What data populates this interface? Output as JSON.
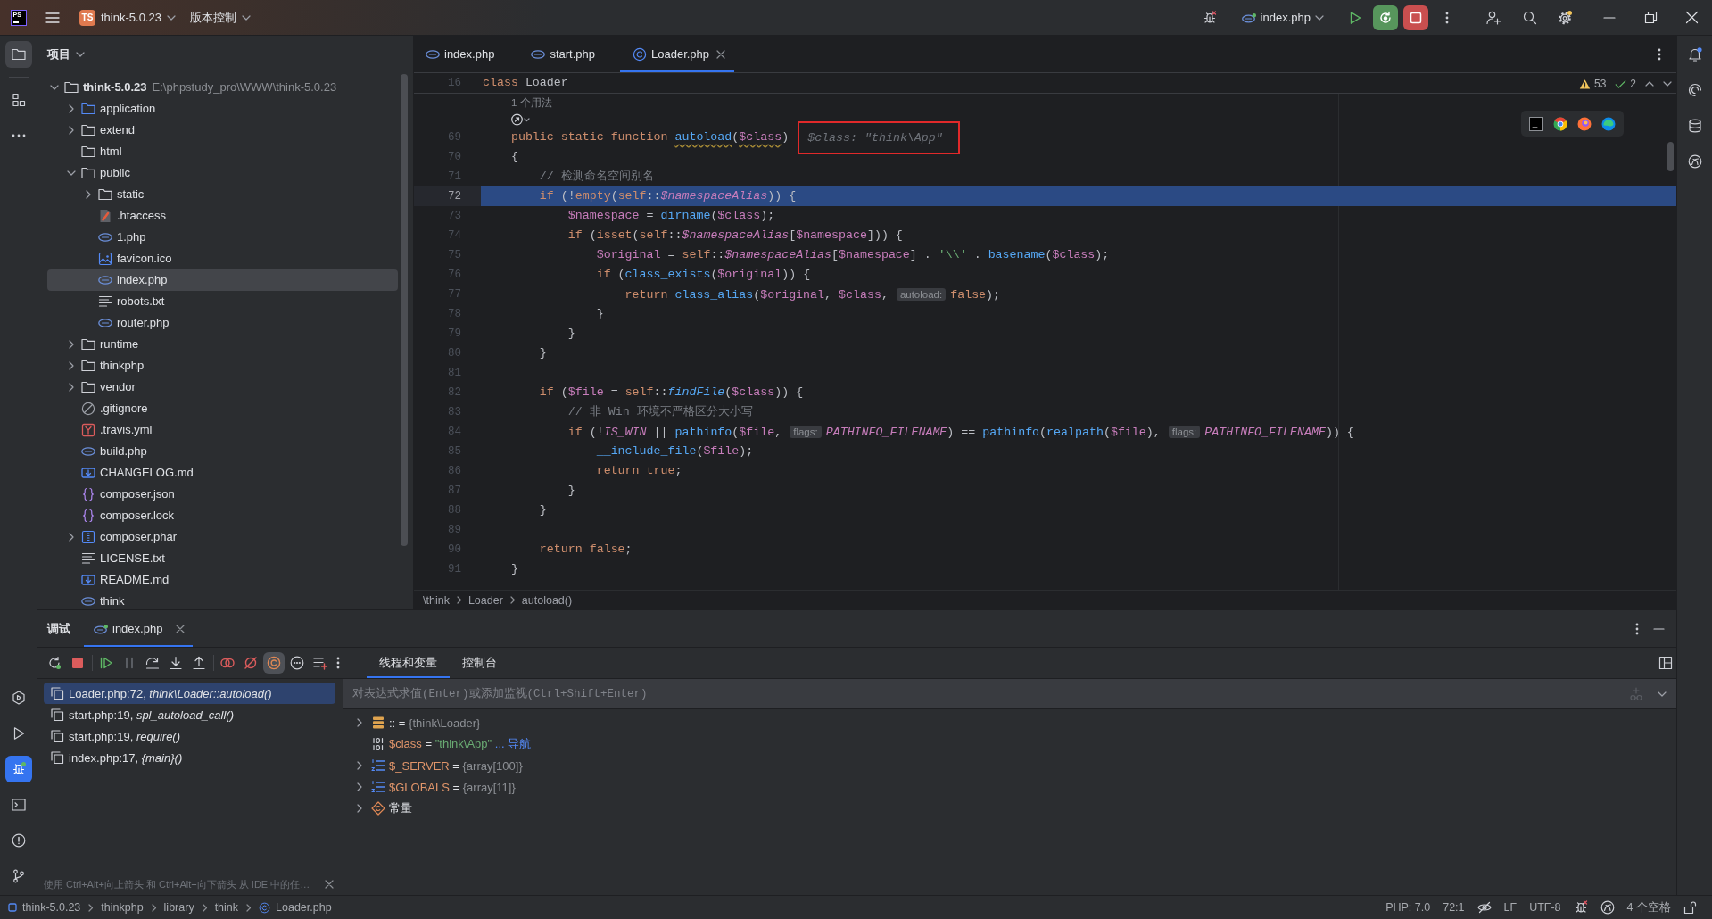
{
  "title_bar": {
    "logo_text": "PS",
    "project_initials": "TS",
    "project_name": "think-5.0.23",
    "vcs_menu": "版本控制",
    "run_config": "index.php"
  },
  "left_toolbar": {
    "top": [
      {
        "kind": "project",
        "selected": true
      },
      {
        "kind": "structure",
        "selected": false
      },
      {
        "kind": "more",
        "selected": false
      }
    ],
    "bottom": [
      {
        "kind": "services",
        "selected": false
      },
      {
        "kind": "run",
        "selected": false
      },
      {
        "kind": "debug",
        "selected": true
      },
      {
        "kind": "terminal",
        "selected": false
      },
      {
        "kind": "problems",
        "selected": false
      },
      {
        "kind": "git",
        "selected": false
      }
    ]
  },
  "project_panel": {
    "title": "项目",
    "tree": [
      {
        "name": "think-5.0.23",
        "path": "E:\\phpstudy_pro\\WWW\\think-5.0.23",
        "kind": "folder",
        "expanded": true,
        "selected": false,
        "children": [
          {
            "name": "application",
            "kind": "source-folder",
            "expanded": false,
            "selected": false
          },
          {
            "name": "extend",
            "kind": "folder",
            "expanded": false,
            "selected": false
          },
          {
            "name": "html",
            "kind": "folder",
            "selected": false
          },
          {
            "name": "public",
            "kind": "folder",
            "expanded": true,
            "selected": false,
            "children": [
              {
                "name": "static",
                "kind": "folder",
                "expanded": false,
                "selected": false
              },
              {
                "name": ".htaccess",
                "kind": "config",
                "selected": false
              },
              {
                "name": "1.php",
                "kind": "php",
                "selected": false
              },
              {
                "name": "favicon.ico",
                "kind": "image",
                "selected": false
              },
              {
                "name": "index.php",
                "kind": "php",
                "selected": true
              },
              {
                "name": "robots.txt",
                "kind": "text",
                "selected": false
              },
              {
                "name": "router.php",
                "kind": "php",
                "selected": false
              }
            ]
          },
          {
            "name": "runtime",
            "kind": "folder",
            "expanded": false,
            "selected": false
          },
          {
            "name": "thinkphp",
            "kind": "folder",
            "expanded": false,
            "selected": false
          },
          {
            "name": "vendor",
            "kind": "folder",
            "expanded": false,
            "selected": false
          },
          {
            "name": ".gitignore",
            "kind": "ignore",
            "selected": false
          },
          {
            "name": ".travis.yml",
            "kind": "yaml",
            "selected": false
          },
          {
            "name": "build.php",
            "kind": "php",
            "selected": false
          },
          {
            "name": "CHANGELOG.md",
            "kind": "markdown",
            "selected": false
          },
          {
            "name": "composer.json",
            "kind": "json",
            "selected": false
          },
          {
            "name": "composer.lock",
            "kind": "json",
            "selected": false
          },
          {
            "name": "composer.phar",
            "kind": "archive",
            "expanded": false,
            "selected": false
          },
          {
            "name": "LICENSE.txt",
            "kind": "text",
            "selected": false
          },
          {
            "name": "README.md",
            "kind": "markdown",
            "selected": false
          },
          {
            "name": "think",
            "kind": "php",
            "selected": false
          }
        ]
      }
    ]
  },
  "editor": {
    "tabs": [
      {
        "label": "index.php",
        "kind": "php",
        "selected": false
      },
      {
        "label": "start.php",
        "kind": "php",
        "selected": false
      },
      {
        "label": "Loader.php",
        "kind": "class",
        "selected": true
      }
    ],
    "sticky_line": {
      "number": "16",
      "tokens": [
        {
          "kind": "keyword",
          "text": "class"
        },
        {
          "kind": "plain",
          "text": " Loader"
        }
      ]
    },
    "usages": "1 个用法",
    "inspections": {
      "warnings": "53",
      "passed": "2"
    },
    "lines": [
      {
        "number": "69",
        "current": false,
        "inline_value": "$class: \"think\\App\"",
        "tokens": [
          {
            "kind": "keyword",
            "text": "    public static function "
          },
          {
            "kind": "declaration",
            "text": "autoload"
          },
          {
            "kind": "plain",
            "text": "("
          },
          {
            "kind": "param",
            "text": "$class"
          },
          {
            "kind": "plain",
            "text": ")"
          }
        ]
      },
      {
        "number": "70",
        "current": false,
        "tokens": [
          {
            "kind": "plain",
            "text": "    {"
          }
        ]
      },
      {
        "number": "71",
        "current": false,
        "tokens": [
          {
            "kind": "comment",
            "text": "        // 检测命名空间别名"
          }
        ]
      },
      {
        "number": "72",
        "current": true,
        "tokens": [
          {
            "kind": "keyword",
            "text": "        if"
          },
          {
            "kind": "plain",
            "text": " (!"
          },
          {
            "kind": "keyword",
            "text": "empty"
          },
          {
            "kind": "plain",
            "text": "("
          },
          {
            "kind": "keyword",
            "text": "self"
          },
          {
            "kind": "plain",
            "text": "::"
          },
          {
            "kind": "field",
            "text": "$namespaceAlias"
          },
          {
            "kind": "plain",
            "text": ")) {"
          }
        ]
      },
      {
        "number": "73",
        "current": false,
        "tokens": [
          {
            "kind": "var",
            "text": "            $namespace"
          },
          {
            "kind": "plain",
            "text": " = "
          },
          {
            "kind": "func",
            "text": "dirname"
          },
          {
            "kind": "plain",
            "text": "("
          },
          {
            "kind": "var",
            "text": "$class"
          },
          {
            "kind": "plain",
            "text": ");"
          }
        ]
      },
      {
        "number": "74",
        "current": false,
        "tokens": [
          {
            "kind": "keyword",
            "text": "            if"
          },
          {
            "kind": "plain",
            "text": " ("
          },
          {
            "kind": "keyword",
            "text": "isset"
          },
          {
            "kind": "plain",
            "text": "("
          },
          {
            "kind": "keyword",
            "text": "self"
          },
          {
            "kind": "plain",
            "text": "::"
          },
          {
            "kind": "field",
            "text": "$namespaceAlias"
          },
          {
            "kind": "plain",
            "text": "["
          },
          {
            "kind": "var",
            "text": "$namespace"
          },
          {
            "kind": "plain",
            "text": "])) {"
          }
        ]
      },
      {
        "number": "75",
        "current": false,
        "tokens": [
          {
            "kind": "var",
            "text": "                $original"
          },
          {
            "kind": "plain",
            "text": " = "
          },
          {
            "kind": "keyword",
            "text": "self"
          },
          {
            "kind": "plain",
            "text": "::"
          },
          {
            "kind": "field",
            "text": "$namespaceAlias"
          },
          {
            "kind": "plain",
            "text": "["
          },
          {
            "kind": "var",
            "text": "$namespace"
          },
          {
            "kind": "plain",
            "text": "] . "
          },
          {
            "kind": "string",
            "text": "'\\\\'"
          },
          {
            "kind": "plain",
            "text": " . "
          },
          {
            "kind": "func",
            "text": "basename"
          },
          {
            "kind": "plain",
            "text": "("
          },
          {
            "kind": "var",
            "text": "$class"
          },
          {
            "kind": "plain",
            "text": ");"
          }
        ]
      },
      {
        "number": "76",
        "current": false,
        "tokens": [
          {
            "kind": "keyword",
            "text": "                if"
          },
          {
            "kind": "plain",
            "text": " ("
          },
          {
            "kind": "func",
            "text": "class_exists"
          },
          {
            "kind": "plain",
            "text": "("
          },
          {
            "kind": "var",
            "text": "$original"
          },
          {
            "kind": "plain",
            "text": ")) {"
          }
        ]
      },
      {
        "number": "77",
        "current": false,
        "tokens": [
          {
            "kind": "keyword",
            "text": "                    return "
          },
          {
            "kind": "func",
            "text": "class_alias"
          },
          {
            "kind": "plain",
            "text": "("
          },
          {
            "kind": "var",
            "text": "$original"
          },
          {
            "kind": "plain",
            "text": ", "
          },
          {
            "kind": "var",
            "text": "$class"
          },
          {
            "kind": "plain",
            "text": ", "
          },
          {
            "kind": "hint",
            "text": "autoload:"
          },
          {
            "kind": "keyword",
            "text": "false"
          },
          {
            "kind": "plain",
            "text": ");"
          }
        ]
      },
      {
        "number": "78",
        "current": false,
        "tokens": [
          {
            "kind": "plain",
            "text": "                }"
          }
        ]
      },
      {
        "number": "79",
        "current": false,
        "tokens": [
          {
            "kind": "plain",
            "text": "            }"
          }
        ]
      },
      {
        "number": "80",
        "current": false,
        "tokens": [
          {
            "kind": "plain",
            "text": "        }"
          }
        ]
      },
      {
        "number": "81",
        "current": false
      },
      {
        "number": "82",
        "current": false,
        "tokens": [
          {
            "kind": "keyword",
            "text": "        if"
          },
          {
            "kind": "plain",
            "text": " ("
          },
          {
            "kind": "var",
            "text": "$file"
          },
          {
            "kind": "plain",
            "text": " = "
          },
          {
            "kind": "keyword",
            "text": "self"
          },
          {
            "kind": "plain",
            "text": "::"
          },
          {
            "kind": "static-call",
            "text": "findFile"
          },
          {
            "kind": "plain",
            "text": "("
          },
          {
            "kind": "var",
            "text": "$class"
          },
          {
            "kind": "plain",
            "text": ")) {"
          }
        ]
      },
      {
        "number": "83",
        "current": false,
        "tokens": [
          {
            "kind": "comment",
            "text": "            // 非 Win 环境不严格区分大小写"
          }
        ]
      },
      {
        "number": "84",
        "current": false,
        "tokens": [
          {
            "kind": "keyword",
            "text": "            if"
          },
          {
            "kind": "plain",
            "text": " (!"
          },
          {
            "kind": "const",
            "text": "IS_WIN"
          },
          {
            "kind": "plain",
            "text": " || "
          },
          {
            "kind": "func",
            "text": "pathinfo"
          },
          {
            "kind": "plain",
            "text": "("
          },
          {
            "kind": "var",
            "text": "$file"
          },
          {
            "kind": "plain",
            "text": ", "
          },
          {
            "kind": "hint",
            "text": "flags:"
          },
          {
            "kind": "const",
            "text": "PATHINFO_FILENAME"
          },
          {
            "kind": "plain",
            "text": ") == "
          },
          {
            "kind": "func",
            "text": "pathinfo"
          },
          {
            "kind": "plain",
            "text": "("
          },
          {
            "kind": "func",
            "text": "realpath"
          },
          {
            "kind": "plain",
            "text": "("
          },
          {
            "kind": "var",
            "text": "$file"
          },
          {
            "kind": "plain",
            "text": "), "
          },
          {
            "kind": "hint",
            "text": "flags:"
          },
          {
            "kind": "const",
            "text": "PATHINFO_FILENAME"
          },
          {
            "kind": "plain",
            "text": ")) {"
          }
        ]
      },
      {
        "number": "85",
        "current": false,
        "tokens": [
          {
            "kind": "func",
            "text": "                __include_file"
          },
          {
            "kind": "plain",
            "text": "("
          },
          {
            "kind": "var",
            "text": "$file"
          },
          {
            "kind": "plain",
            "text": ");"
          }
        ]
      },
      {
        "number": "86",
        "current": false,
        "tokens": [
          {
            "kind": "keyword",
            "text": "                return true"
          },
          {
            "kind": "plain",
            "text": ";"
          }
        ]
      },
      {
        "number": "87",
        "current": false,
        "tokens": [
          {
            "kind": "plain",
            "text": "            }"
          }
        ]
      },
      {
        "number": "88",
        "current": false,
        "tokens": [
          {
            "kind": "plain",
            "text": "        }"
          }
        ]
      },
      {
        "number": "89",
        "current": false
      },
      {
        "number": "90",
        "current": false,
        "tokens": [
          {
            "kind": "keyword",
            "text": "        return false"
          },
          {
            "kind": "plain",
            "text": ";"
          }
        ]
      },
      {
        "number": "91",
        "current": false,
        "tokens": [
          {
            "kind": "plain",
            "text": "    }"
          }
        ]
      }
    ],
    "breadcrumbs": [
      "\\think",
      "Loader",
      "autoload()"
    ]
  },
  "debug_panel": {
    "title": "调试",
    "sessions": [
      {
        "label": "index.php",
        "selected": true
      }
    ],
    "show_constants": true,
    "views": [
      {
        "label": "线程和变量",
        "selected": true
      },
      {
        "label": "控制台",
        "selected": false
      }
    ],
    "frames": [
      {
        "text": "Loader.php:72, *think\\Loader::autoload()*",
        "selected": true
      },
      {
        "text": "start.php:19, *spl_autoload_call()*",
        "selected": false
      },
      {
        "text": "start.php:19, *require()*",
        "selected": false
      },
      {
        "text": "index.php:17, *{main}()*",
        "selected": false
      }
    ],
    "frames_hint": "使用 Ctrl+Alt+向上箭头 和 Ctrl+Alt+向下箭头 从 IDE 中的任…",
    "evaluate_placeholder": "对表达式求值(Enter)或添加监视(Ctrl+Shift+Enter)",
    "variables": [
      {
        "kind": "object",
        "name": "::",
        "operator": "=",
        "value": "{think\\Loader}",
        "expanded": false
      },
      {
        "kind": "string",
        "name": "$class",
        "operator": "=",
        "value": "\"think\\App\"",
        "link": "... 导航"
      },
      {
        "kind": "array",
        "name": "$_SERVER",
        "operator": "=",
        "value": "{array[100]}",
        "expanded": false
      },
      {
        "kind": "array",
        "name": "$GLOBALS",
        "operator": "=",
        "value": "{array[11]}",
        "expanded": false
      },
      {
        "kind": "group",
        "name": "常量",
        "expanded": false
      }
    ]
  },
  "status_bar": {
    "path": [
      {
        "kind": "module",
        "label": "think-5.0.23"
      },
      {
        "kind": "folder",
        "label": "thinkphp"
      },
      {
        "kind": "folder",
        "label": "library"
      },
      {
        "kind": "folder",
        "label": "think"
      },
      {
        "kind": "class",
        "label": "Loader.php"
      }
    ],
    "php_level": "PHP: 7.0",
    "caret": "72:1",
    "line_separator": "LF",
    "encoding": "UTF-8",
    "indent": "4 个空格"
  }
}
